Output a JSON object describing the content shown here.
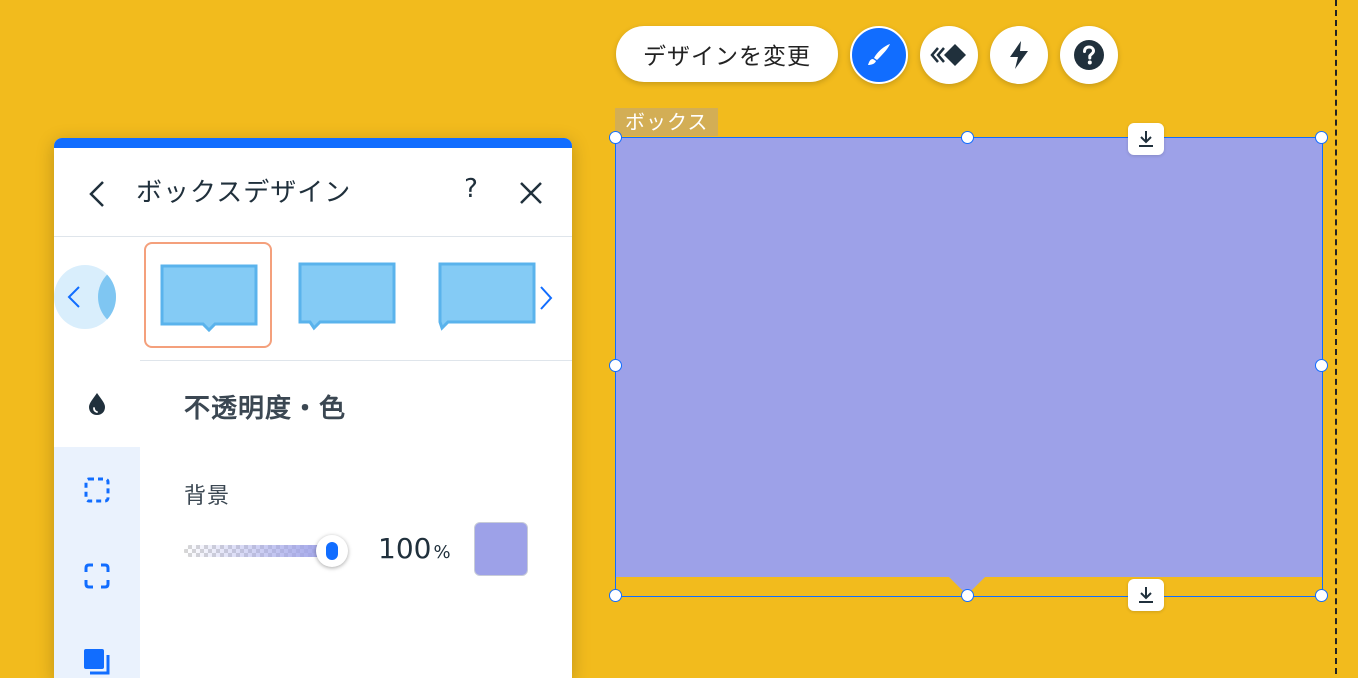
{
  "colors": {
    "canvas": "#f2bb1d",
    "accent": "#116dff",
    "box_fill": "#9da1e8",
    "preset_fill": "#84cbf5",
    "preset_border": "#5ab3ec",
    "selected_preset_border": "#f4a07c"
  },
  "toolbar": {
    "change_design_label": "デザインを変更",
    "buttons": [
      {
        "icon": "brush-icon",
        "active": true
      },
      {
        "icon": "animation-icon",
        "active": false
      },
      {
        "icon": "lightning-icon",
        "active": false
      },
      {
        "icon": "help-circle-icon",
        "active": false
      }
    ]
  },
  "box": {
    "tag_label": "ボックス"
  },
  "panel": {
    "title": "ボックスデザイン",
    "help_label": "?",
    "presets": [
      {
        "name": "box-with-bottom-tail",
        "selected": true
      },
      {
        "name": "box-with-left-tail",
        "selected": false
      },
      {
        "name": "box-with-corner-tail",
        "selected": false
      }
    ],
    "side_tabs": [
      "fill-icon",
      "border-icon",
      "corners-icon",
      "shadow-icon"
    ],
    "section_title": "不透明度・色",
    "background_label": "背景",
    "opacity": {
      "value": "100",
      "unit": "%",
      "level": 1.0
    }
  }
}
